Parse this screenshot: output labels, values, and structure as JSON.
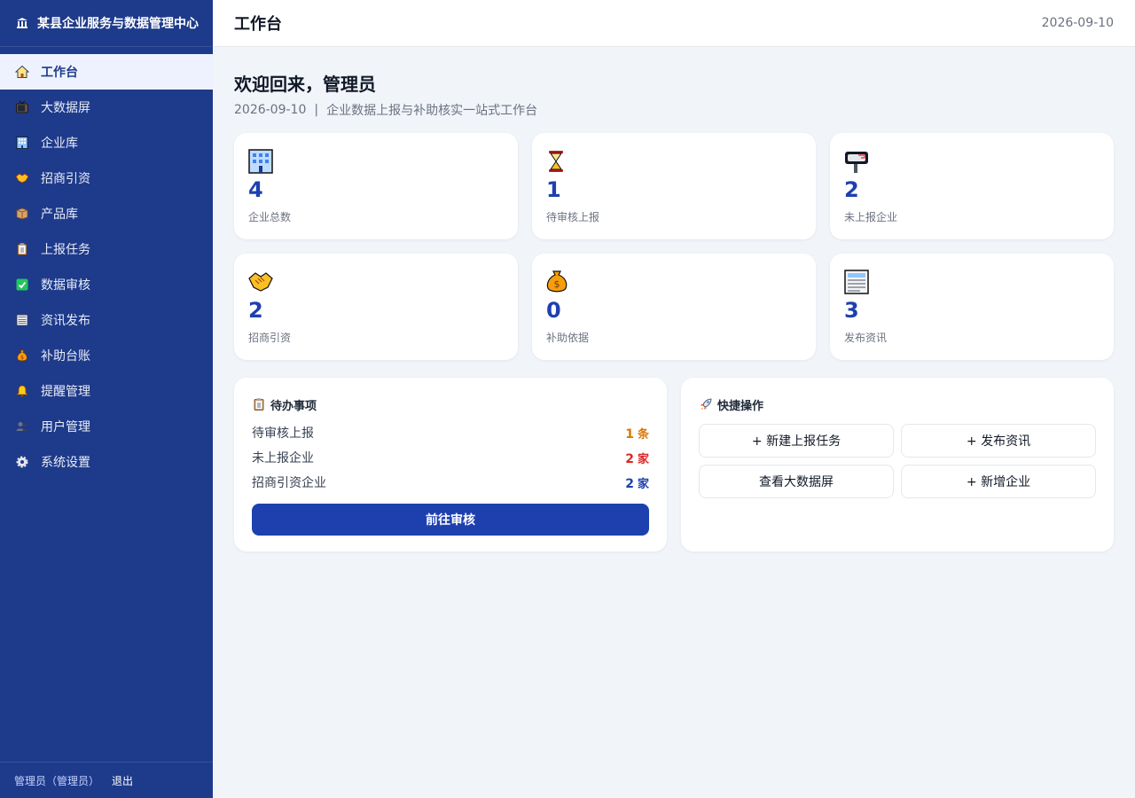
{
  "brand": {
    "title": "某县企业服务与数据管理中心",
    "icon": "government-building-icon"
  },
  "sidebar": {
    "items": [
      {
        "label": "工作台",
        "icon": "home-icon",
        "active": true
      },
      {
        "label": "大数据屏",
        "icon": "tv-icon"
      },
      {
        "label": "企业库",
        "icon": "office-building-icon"
      },
      {
        "label": "招商引资",
        "icon": "handshake-icon"
      },
      {
        "label": "产品库",
        "icon": "package-icon"
      },
      {
        "label": "上报任务",
        "icon": "clipboard-icon"
      },
      {
        "label": "数据审核",
        "icon": "check-box-icon"
      },
      {
        "label": "资讯发布",
        "icon": "newspaper-icon"
      },
      {
        "label": "补助台账",
        "icon": "money-bag-icon"
      },
      {
        "label": "提醒管理",
        "icon": "bell-icon"
      },
      {
        "label": "用户管理",
        "icon": "users-icon"
      },
      {
        "label": "系统设置",
        "icon": "gear-icon"
      }
    ],
    "footer": {
      "user": "管理员（管理员）",
      "logout": "退出"
    }
  },
  "topbar": {
    "title": "工作台",
    "date": "2026-09-10"
  },
  "welcome": {
    "title": "欢迎回来，管理员",
    "date": "2026-09-10",
    "separator": "|",
    "subtitle": "企业数据上报与补助核实一站式工作台"
  },
  "stats": [
    {
      "value": "4",
      "label": "企业总数",
      "icon": "office-building-icon"
    },
    {
      "value": "1",
      "label": "待审核上报",
      "icon": "hourglass-icon"
    },
    {
      "value": "2",
      "label": "未上报企业",
      "icon": "mailbox-icon"
    },
    {
      "value": "2",
      "label": "招商引资",
      "icon": "handshake-icon"
    },
    {
      "value": "0",
      "label": "补助依据",
      "icon": "money-bag-icon"
    },
    {
      "value": "3",
      "label": "发布资讯",
      "icon": "newspaper-icon"
    }
  ],
  "todo": {
    "title": "待办事项",
    "icon": "clipboard-icon",
    "rows": [
      {
        "label": "待审核上报",
        "num": "1",
        "unit": "条",
        "color": "#d97706"
      },
      {
        "label": "未上报企业",
        "num": "2",
        "unit": "家",
        "color": "#dc2626"
      },
      {
        "label": "招商引资企业",
        "num": "2",
        "unit": "家",
        "color": "#1e40af"
      }
    ],
    "button": "前往审核"
  },
  "quick": {
    "title": "快捷操作",
    "icon": "rocket-icon",
    "buttons": [
      "+ 新建上报任务",
      "+ 发布资讯",
      "查看大数据屏",
      "+ 新增企业"
    ]
  },
  "colors": {
    "sidebar": "#1e3a8a",
    "accent": "#1e40af",
    "background": "#f1f4f9"
  }
}
